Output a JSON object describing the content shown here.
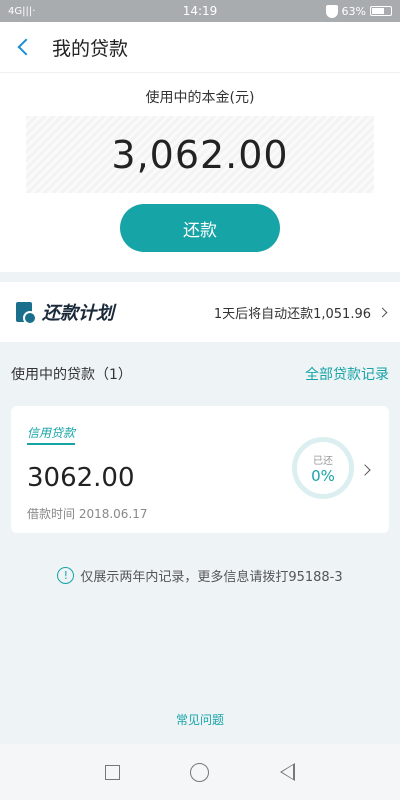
{
  "status_bar": {
    "left": "4G|||·",
    "time": "14:19",
    "battery": "63%"
  },
  "nav": {
    "title": "我的贷款"
  },
  "principal": {
    "label": "使用中的本金(元)",
    "amount": "3,062.00",
    "repay_label": "还款"
  },
  "plan": {
    "title": "还款计划",
    "info": "1天后将自动还款1,051.96"
  },
  "loans": {
    "label": "使用中的贷款（1）",
    "all_records": "全部贷款记录",
    "items": [
      {
        "type": "信用贷款",
        "amount": "3062.00",
        "date": "借款时间 2018.06.17",
        "repaid_label": "已还",
        "repaid_pct": "0%"
      }
    ]
  },
  "notice": "仅展示两年内记录，更多信息请拨打95188-3",
  "faq": "常见问题",
  "colors": {
    "accent": "#16a4a7",
    "back": "#1a8fd6"
  }
}
